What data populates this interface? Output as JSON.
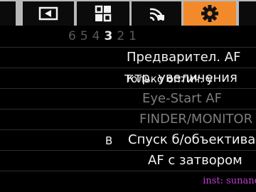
{
  "tabs": [
    {
      "icon": "camera-icon",
      "active": false
    },
    {
      "icon": "playback-icon",
      "active": false
    },
    {
      "icon": "custom-menu-icon",
      "active": false
    },
    {
      "icon": "wireless-icon",
      "active": false
    },
    {
      "icon": "gear-icon",
      "active": true
    }
  ],
  "pager": {
    "pages": [
      "1",
      "2",
      "3",
      "4",
      "5",
      "6"
    ],
    "current": "3"
  },
  "menu": {
    "rows": [
      {
        "label": "Предварител. AF",
        "value": "",
        "enabled": true
      },
      {
        "label": "ктр. увеличения",
        "value": "Только оптич. у",
        "enabled": true
      },
      {
        "label": "Eye-Start AF",
        "value": "",
        "enabled": false
      },
      {
        "label": "FINDER/MONITOR",
        "value": "",
        "enabled": false
      },
      {
        "label": "Спуск б/объектива",
        "value": "В",
        "enabled": true
      },
      {
        "label": "AF с затвором",
        "value": "",
        "enabled": true
      }
    ]
  },
  "watermark": "inst: sunand"
}
